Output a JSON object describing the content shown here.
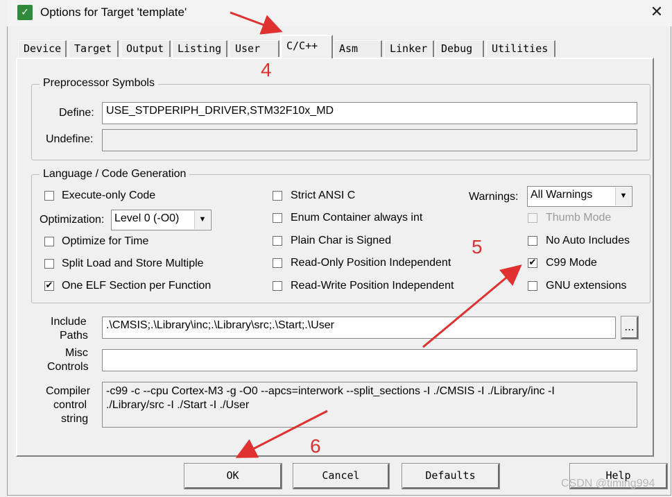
{
  "window": {
    "title": "Options for Target 'template'",
    "close_glyph": "✕",
    "icon": "keil-app-icon"
  },
  "tabs": [
    {
      "label": "Device"
    },
    {
      "label": "Target"
    },
    {
      "label": "Output"
    },
    {
      "label": "Listing"
    },
    {
      "label": "User"
    },
    {
      "label": "C/C++"
    },
    {
      "label": "Asm"
    },
    {
      "label": "Linker"
    },
    {
      "label": "Debug"
    },
    {
      "label": "Utilities"
    }
  ],
  "active_tab": "C/C++",
  "preprocessor": {
    "legend": "Preprocessor Symbols",
    "define_label": "Define:",
    "define_value": "USE_STDPERIPH_DRIVER,STM32F10x_MD",
    "undefine_label": "Undefine:",
    "undefine_value": ""
  },
  "language": {
    "legend": "Language / Code Generation",
    "execute_only": {
      "label": "Execute-only Code",
      "checked": false
    },
    "optimization_label": "Optimization:",
    "optimization_value": "Level 0 (-O0)",
    "optimize_time": {
      "label": "Optimize for Time",
      "checked": false
    },
    "split_load": {
      "label": "Split Load and Store Multiple",
      "checked": false
    },
    "one_elf": {
      "label": "One ELF Section per Function",
      "checked": true
    },
    "strict_ansi": {
      "label": "Strict ANSI C",
      "checked": false
    },
    "enum_container": {
      "label": "Enum Container always int",
      "checked": false
    },
    "plain_char": {
      "label": "Plain Char is Signed",
      "checked": false
    },
    "ro_pos": {
      "label": "Read-Only Position Independent",
      "checked": false
    },
    "rw_pos": {
      "label": "Read-Write Position Independent",
      "checked": false
    },
    "warnings_label": "Warnings:",
    "warnings_value": "All Warnings",
    "thumb_mode": {
      "label": "Thumb Mode",
      "checked": false,
      "disabled": true
    },
    "no_auto_includes": {
      "label": "No Auto Includes",
      "checked": false
    },
    "c99_mode": {
      "label": "C99 Mode",
      "checked": true
    },
    "gnu_extensions": {
      "label": "GNU extensions",
      "checked": false
    }
  },
  "include_paths": {
    "label_line1": "Include",
    "label_line2": "Paths",
    "value": ".\\CMSIS;.\\Library\\inc;.\\Library\\src;.\\Start;.\\User",
    "browse": "..."
  },
  "misc_controls": {
    "label_line1": "Misc",
    "label_line2": "Controls",
    "value": ""
  },
  "compiler_string": {
    "label_line1": "Compiler",
    "label_line2": "control",
    "label_line3": "string",
    "line1": "-c99 -c --cpu Cortex-M3 -g -O0 --apcs=interwork --split_sections -I ./CMSIS -I ./Library/inc -I",
    "line2": "./Library/src -I ./Start -I ./User"
  },
  "buttons": {
    "ok": "OK",
    "cancel": "Cancel",
    "defaults": "Defaults",
    "help": "Help"
  },
  "annotations": {
    "n4": "4",
    "n5": "5",
    "n6": "6",
    "color": "#e03030"
  },
  "watermark": "CSDN @timing994",
  "checkmark": "✔"
}
